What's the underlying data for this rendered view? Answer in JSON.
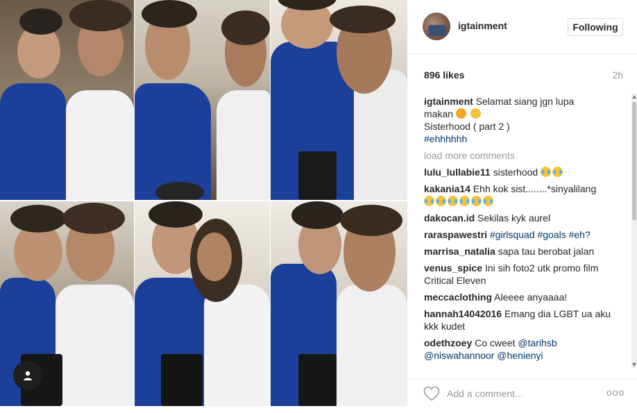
{
  "post": {
    "username": "igtainment",
    "follow_label": "Following",
    "likes": "896 likes",
    "time": "2h"
  },
  "caption": {
    "author": "igtainment",
    "line1": "Selamat siang jgn lupa",
    "line2": "makan",
    "line3": "Sisterhood ( part 2 )",
    "hashtag": "#ehhhhhh"
  },
  "load_more": "load more comments",
  "comments": [
    {
      "author": "lulu_lullabie11",
      "text": "sisterhood"
    },
    {
      "author": "kakania14",
      "text": "Ehh kok sist........*sinyalilang"
    },
    {
      "author": "dakocan.id",
      "text": "Sekilas kyk aurel"
    },
    {
      "author": "raraspawestri",
      "text": "#girlsquad #goals #eh?"
    },
    {
      "author": "marrisa_natalia",
      "text": "sapa tau berobat jalan"
    },
    {
      "author": "venus_spice",
      "text": "Ini sih foto2 utk promo film Critical Eleven"
    },
    {
      "author": "meccaclothing",
      "text": "Aleeee anyaaaa!"
    },
    {
      "author": "hannah14042016",
      "text": "Emang dia LGBT ua aku kkk kudet"
    },
    {
      "author": "odethzoey",
      "text": "Co cweet",
      "mention1": "@tarihsb",
      "mention2": "@niswahannoor",
      "mention3": "@henienyi"
    }
  ],
  "footer": {
    "comment_placeholder": "Add a comment...",
    "more_label": "ooo"
  },
  "icons": {
    "heart": "heart-icon",
    "user_tag": "user-tag-icon",
    "more": "more-options-icon"
  },
  "colors": {
    "jersey_blue": "#1c3f9a",
    "link_blue": "#003569",
    "muted_gray": "#999999"
  }
}
